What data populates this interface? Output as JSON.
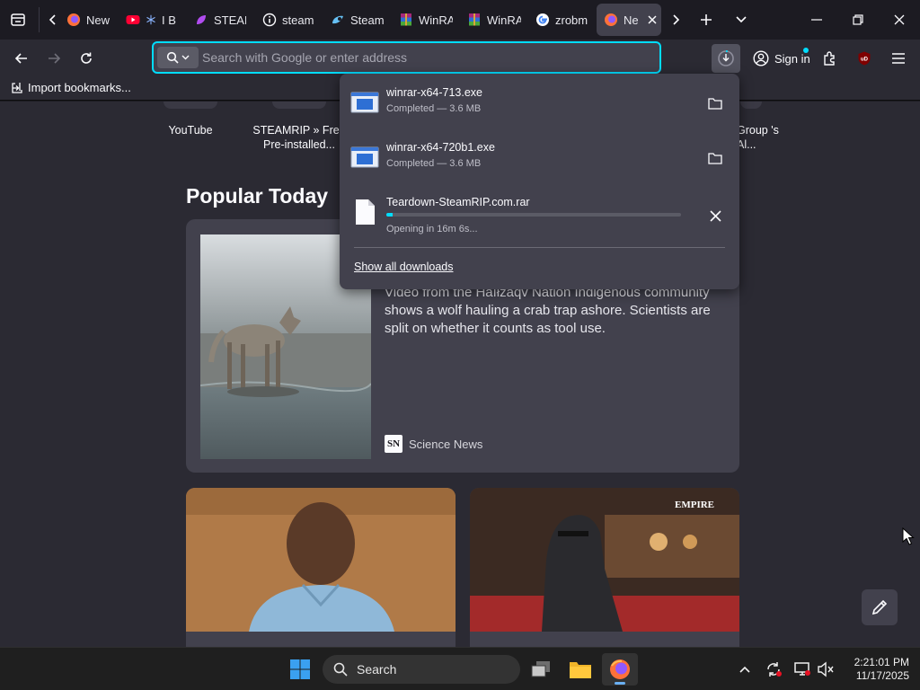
{
  "tabs": [
    {
      "title": "New T",
      "icon": "firefox-icon"
    },
    {
      "title": "I B",
      "icon": "youtube-icon"
    },
    {
      "title": "STEAM",
      "icon": "steamrip-icon"
    },
    {
      "title": "steam",
      "icon": "info-icon"
    },
    {
      "title": "Steam",
      "icon": "steam-icon"
    },
    {
      "title": "WinRA",
      "icon": "winrar-icon"
    },
    {
      "title": "WinRA",
      "icon": "winrar-icon"
    },
    {
      "title": "zrobm",
      "icon": "google-icon"
    },
    {
      "title": "Ne",
      "icon": "firefox-icon",
      "active": true
    }
  ],
  "urlbar": {
    "placeholder": "Search with Google or enter address"
  },
  "toolbar": {
    "sign_in": "Sign in"
  },
  "bookmarks": {
    "import": "Import bookmarks..."
  },
  "shortcuts": [
    {
      "label": "YouTube"
    },
    {
      "label": "STEAMRIP » Free Pre-installed..."
    },
    {
      "label": "Group 's Al..."
    }
  ],
  "popular": {
    "title": "Popular Today",
    "hero": {
      "description": "Video from the Haíłzaqv Nation Indigenous community shows a wolf hauling a crab trap ashore. Scientists are split on whether it counts as tool use.",
      "source": "Science News",
      "source_logo": "SN"
    }
  },
  "downloads": {
    "items": [
      {
        "name": "winrar-x64-713.exe",
        "status": "Completed — 3.6 MB",
        "action": "folder-icon"
      },
      {
        "name": "winrar-x64-720b1.exe",
        "status": "Completed — 3.6 MB",
        "action": "folder-icon"
      },
      {
        "name": "Teardown-SteamRIP.com.rar",
        "status": "Opening in 16m 6s...",
        "action": "close-icon",
        "progress": 0.02
      }
    ],
    "show_all": "Show all downloads"
  },
  "taskbar": {
    "search": "Search",
    "time": "2:21:01 PM",
    "date": "11/17/2025"
  },
  "colors": {
    "accent": "#00ddff",
    "panel": "#42414d",
    "toolbar": "#2b2a33",
    "tabstrip": "#1c1b22"
  }
}
